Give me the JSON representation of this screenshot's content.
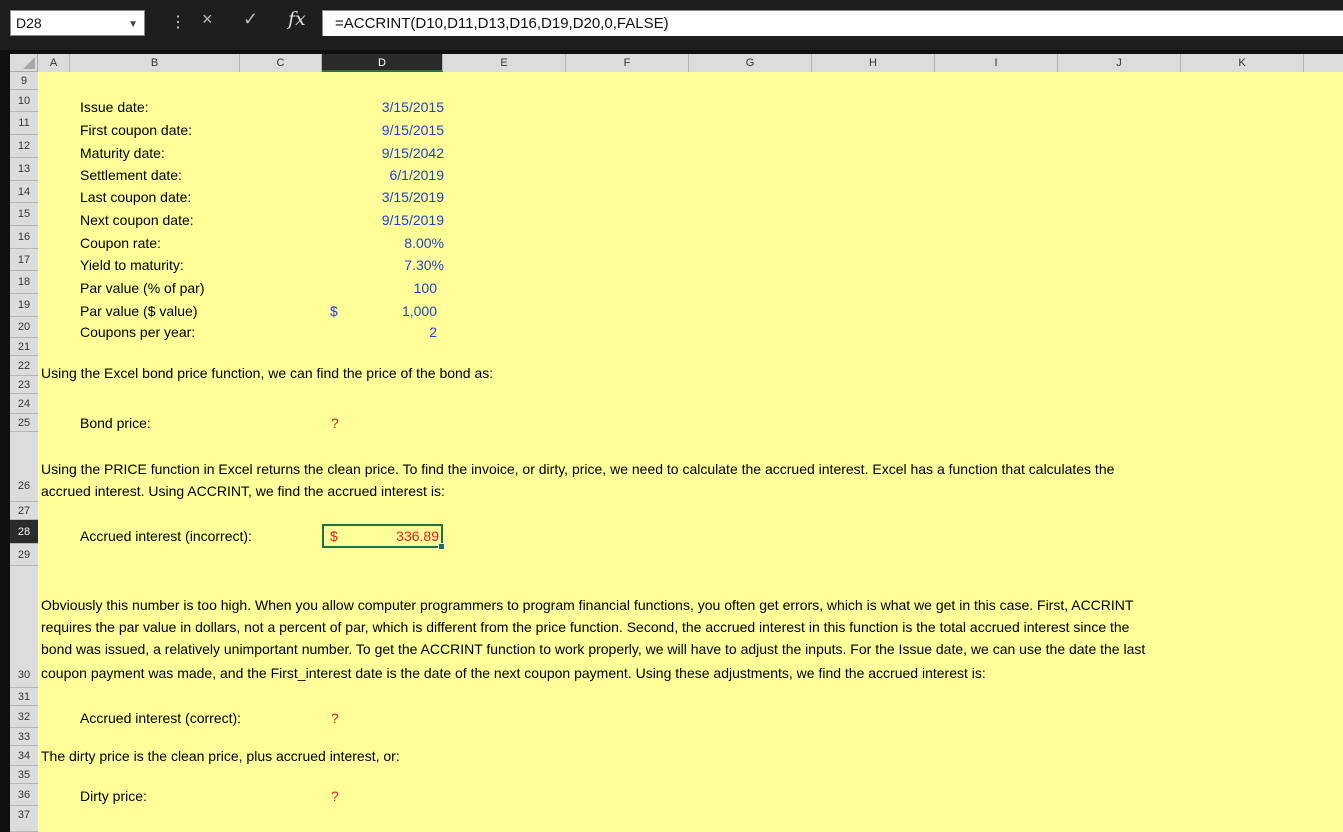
{
  "formula_bar": {
    "name_box": "D28",
    "cancel_icon": "×",
    "enter_icon": "✓",
    "fx_label": "fx",
    "formula": "=ACCRINT(D10,D11,D13,D16,D19,D20,0,FALSE)"
  },
  "columns": [
    "A",
    "B",
    "C",
    "D",
    "E",
    "F",
    "G",
    "H",
    "I",
    "J",
    "K"
  ],
  "selected_column": "D",
  "rows": [
    "9",
    "10",
    "11",
    "12",
    "13",
    "14",
    "15",
    "16",
    "17",
    "18",
    "19",
    "20",
    "21",
    "22",
    "23",
    "24",
    "25",
    "26",
    "27",
    "28",
    "29",
    "30",
    "31",
    "32",
    "33",
    "34",
    "35",
    "36",
    "37"
  ],
  "selected_row": "28",
  "inputs": [
    {
      "label": "Issue date:",
      "value": "3/15/2015"
    },
    {
      "label": "First coupon date:",
      "value": "9/15/2015"
    },
    {
      "label": "Maturity date:",
      "value": "9/15/2042"
    },
    {
      "label": "Settlement date:",
      "value": "6/1/2019"
    },
    {
      "label": "Last coupon date:",
      "value": "3/15/2019"
    },
    {
      "label": "Next coupon date:",
      "value": "9/15/2019"
    },
    {
      "label": "Coupon rate:",
      "value": "8.00%"
    },
    {
      "label": "Yield to maturity:",
      "value": "7.30%"
    },
    {
      "label": "Par value (% of par)",
      "value": "100"
    },
    {
      "label": "Par value ($ value)",
      "currency": "$",
      "value": "1,000"
    },
    {
      "label": "Coupons per year:",
      "value": "2"
    }
  ],
  "text": {
    "r22": "Using the Excel bond price function, we can find the price of the bond as:",
    "bond_price_label": "Bond price:",
    "bond_price_value": "?",
    "r26_line1": "Using the PRICE function in Excel returns the clean price. To find the invoice, or dirty, price, we need to calculate the accrued interest. Excel has a function that calculates the",
    "r26_line2": "accrued interest. Using ACCRINT, we find the accrued interest is:",
    "accrued_incorrect_label": "Accrued interest (incorrect):",
    "accrued_incorrect_currency": "$",
    "accrued_incorrect_value": "336.89",
    "r30_line1": "Obviously this number is too high. When you allow computer programmers to program financial functions, you often get errors, which is what we get in this case. First, ACCRINT",
    "r30_line2": "requires the par value in dollars, not a percent of par, which is different from the price function. Second, the accrued interest in this function is the total accrued interest since the",
    "r30_line3": "bond was issued, a relatively unimportant number. To get the ACCRINT function to work properly, we will have to adjust the inputs. For the Issue date, we can use the date the last",
    "r30_line4": "coupon payment was made, and the First_interest date is the date of the next coupon payment. Using these adjustments, we find the accrued interest is:",
    "accrued_correct_label": "Accrued interest (correct):",
    "accrued_correct_value": "?",
    "r34": "The dirty price is the clean price, plus accrued interest, or:",
    "dirty_price_label": "Dirty price:",
    "dirty_price_value": "?"
  }
}
